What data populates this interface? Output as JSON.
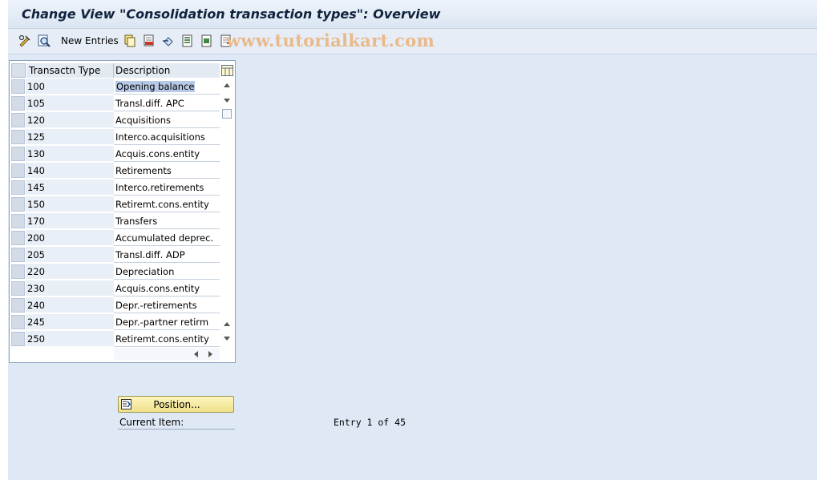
{
  "window": {
    "title": "Change View \"Consolidation transaction types\": Overview"
  },
  "toolbar": {
    "new_entries_label": "New Entries",
    "icons": [
      "display-change-icon",
      "details-icon",
      "copy-icon",
      "delete-icon",
      "undo-icon",
      "select-all-icon",
      "select-block-icon",
      "deselect-all-icon"
    ]
  },
  "watermark": "www.tutorialkart.com",
  "table": {
    "columns": [
      "Transactn Type",
      "Description"
    ],
    "rows": [
      {
        "type": "100",
        "description": "Opening balance"
      },
      {
        "type": "105",
        "description": "Transl.diff. APC"
      },
      {
        "type": "120",
        "description": "Acquisitions"
      },
      {
        "type": "125",
        "description": "Interco.acquisitions"
      },
      {
        "type": "130",
        "description": "Acquis.cons.entity"
      },
      {
        "type": "140",
        "description": "Retirements"
      },
      {
        "type": "145",
        "description": "Interco.retirements"
      },
      {
        "type": "150",
        "description": "Retiremt.cons.entity"
      },
      {
        "type": "170",
        "description": "Transfers"
      },
      {
        "type": "200",
        "description": "Accumulated deprec."
      },
      {
        "type": "205",
        "description": "Transl.diff. ADP"
      },
      {
        "type": "220",
        "description": "Depreciation"
      },
      {
        "type": "230",
        "description": "Acquis.cons.entity"
      },
      {
        "type": "240",
        "description": "Depr.-retirements"
      },
      {
        "type": "245",
        "description": "Depr.-partner retirm"
      },
      {
        "type": "250",
        "description": "Retiremt.cons.entity"
      }
    ]
  },
  "position_button": {
    "label": "Position..."
  },
  "current_item": {
    "label": "Current Item:"
  },
  "entry_status": "Entry 1 of 45"
}
